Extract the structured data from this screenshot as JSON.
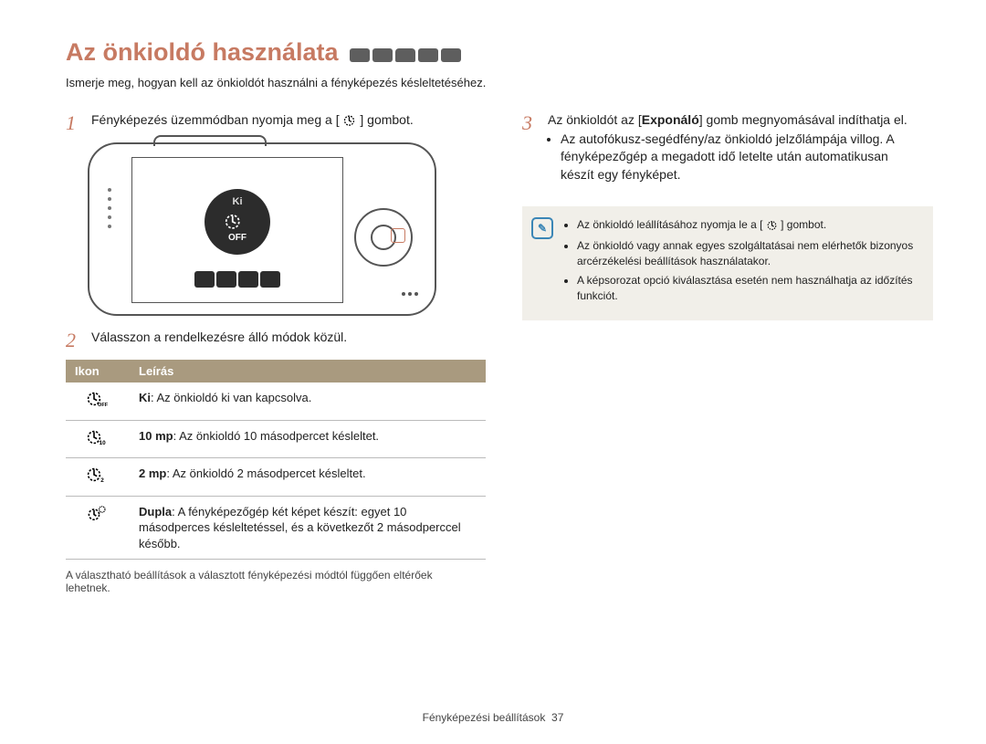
{
  "title": "Az önkioldó használata",
  "intro": "Ismerje meg, hogyan kell az önkioldót használni a fényképezés késleltetéséhez.",
  "steps": {
    "s1_pre": "Fényképezés üzemmódban nyomja meg a [",
    "s1_post": "] gombot.",
    "s2": "Válasszon a rendelkezésre álló módok közül.",
    "s3_pre": "Az önkioldót az [",
    "s3_bold": "Exponáló",
    "s3_post": "] gomb megnyomásával indíthatja el.",
    "s3_bullet": "Az autofókusz-segédfény/az önkioldó jelzőlámpája villog. A fényképezőgép a megadott idő letelte után automatikusan készít egy fényképet."
  },
  "camera": {
    "hub_top": "Ki",
    "hub_off": "OFF"
  },
  "table": {
    "h_icon": "Ikon",
    "h_desc": "Leírás",
    "rows": [
      {
        "sub": "OFF",
        "b": "Ki",
        "rest": ": Az önkioldó ki van kapcsolva."
      },
      {
        "sub": "10",
        "b": "10 mp",
        "rest": ": Az önkioldó 10 másodpercet késleltet."
      },
      {
        "sub": "2",
        "b": "2 mp",
        "rest": ": Az önkioldó 2 másodpercet késleltet."
      },
      {
        "sub": "",
        "b": "Dupla",
        "rest": ": A fényképezőgép két képet készít: egyet 10 másodperces késleltetéssel, és a következőt 2 másodperccel később."
      }
    ]
  },
  "after_table_note": "A választható beállítások a választott fényképezési módtól függően eltérőek lehetnek.",
  "infobox": {
    "i1_pre": "Az önkioldó leállításához nyomja le a [",
    "i1_post": "] gombot.",
    "i2": "Az önkioldó vagy annak egyes szolgáltatásai nem elérhetők bizonyos arcérzékelési beállítások használatakor.",
    "i3": "A képsorozat opció kiválasztása esetén nem használhatja az időzítés funkciót."
  },
  "footer_text": "Fényképezési beállítások",
  "footer_page": "37"
}
